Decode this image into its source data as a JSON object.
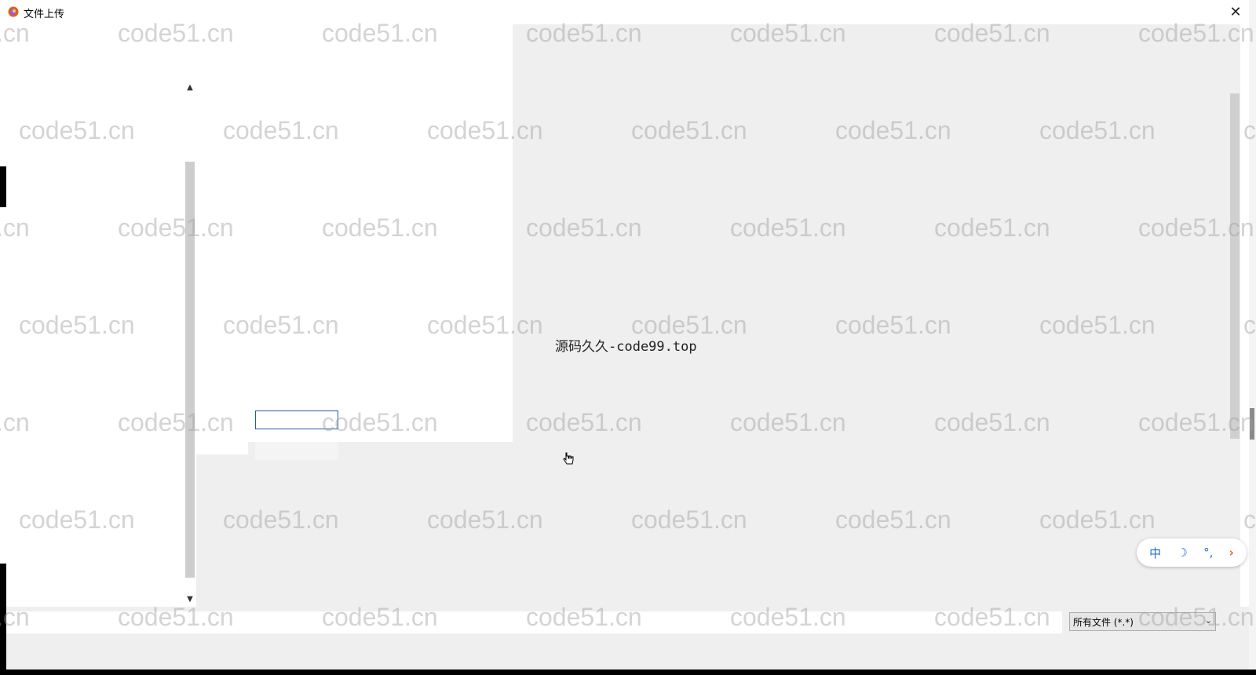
{
  "window": {
    "title": "文件上传"
  },
  "content": {
    "caption": "源码久久-code99.top",
    "rename_value": ""
  },
  "footer": {
    "filename_value": "",
    "file_type_selected": "所有文件 (*.*)"
  },
  "ime": {
    "mode_label": "中",
    "moon_glyph": "☽",
    "punct_glyph": "°,",
    "more_glyph": "›"
  },
  "watermark": {
    "text": "code51.cn"
  },
  "icons": [
    "firefox-icon",
    "close-icon",
    "chevron-up-icon",
    "chevron-down-icon",
    "hand-cursor-icon"
  ]
}
